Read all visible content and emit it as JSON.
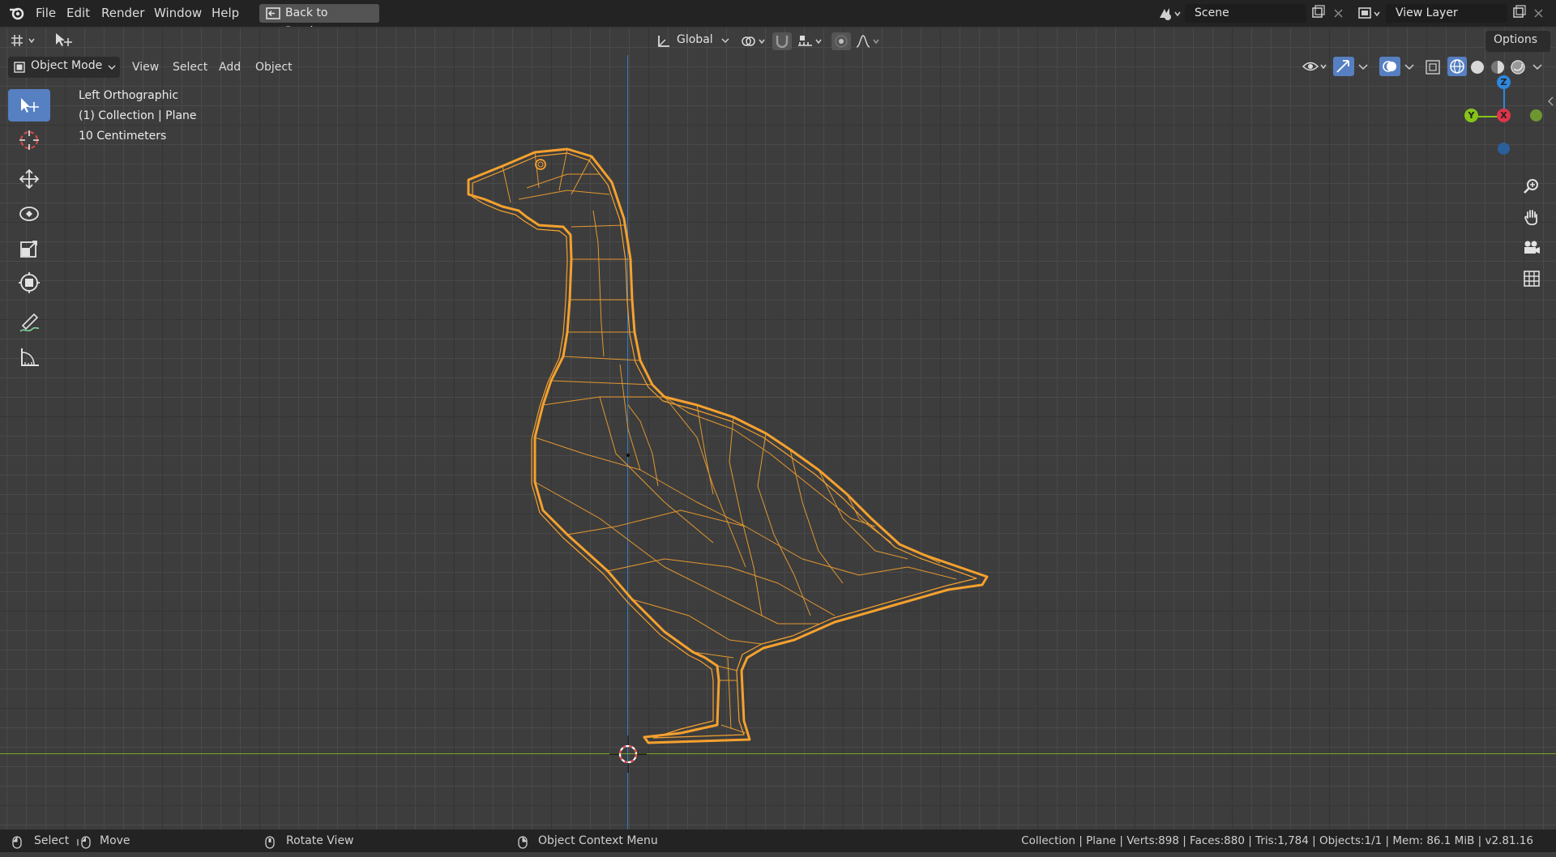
{
  "menu": {
    "file": "File",
    "edit": "Edit",
    "render": "Render",
    "window": "Window",
    "help": "Help",
    "back_button": "Back to Previous"
  },
  "scene": {
    "label": "Scene"
  },
  "view_layer": {
    "label": "View Layer"
  },
  "header": {
    "orientation": "Global",
    "options": "Options"
  },
  "viewport_header": {
    "mode": "Object Mode",
    "view": "View",
    "select": "Select",
    "add": "Add",
    "object": "Object"
  },
  "overlay": {
    "view_name": "Left Orthographic",
    "collection": "(1) Collection | Plane",
    "scale": "10 Centimeters"
  },
  "gizmo": {
    "z": "Z",
    "y": "Y",
    "x": "X"
  },
  "status": {
    "select": "Select",
    "move": "Move",
    "rotate": "Rotate View",
    "context": "Object Context Menu",
    "stats": "Collection | Plane | Verts:898 | Faces:880 | Tris:1,784 | Objects:1/1 | Mem: 86.1 MiB | v2.81.16"
  },
  "colors": {
    "selection": "#f5a12e",
    "active_tool": "#5680c2",
    "axis_x": "#e0344b",
    "axis_y": "#86c418",
    "axis_z": "#2d88e0"
  }
}
